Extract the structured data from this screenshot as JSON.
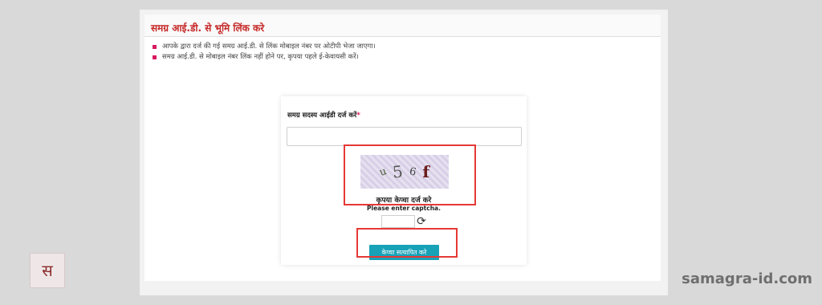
{
  "header": {
    "title": "समग्र आई.डी. से भूमि लिंक करे"
  },
  "notes": [
    "आपके द्वारा दर्ज की गई समग्र आई.डी. से लिंक मोबाइल नंबर पर ओटीपी भेजा जाएगा।",
    "समग्र आई.डी. से मोबाइल नंबर लिंक नहीं होने पर, कृपया पहले ई-केवायसी करें।"
  ],
  "form": {
    "field_label": "समग्र सदस्य आईडी दर्ज करें",
    "required_mark": "*",
    "samagra_value": "",
    "captcha_text": [
      "u",
      "5",
      "6",
      "f"
    ],
    "captcha_title": "कृपया केप्चा दर्ज करे",
    "captcha_sub": "Please enter captcha.",
    "captcha_value": "",
    "verify_label": "केप्चा सत्यापित करे"
  },
  "logo": {
    "text": "स"
  },
  "watermark": "samagra-id.com"
}
